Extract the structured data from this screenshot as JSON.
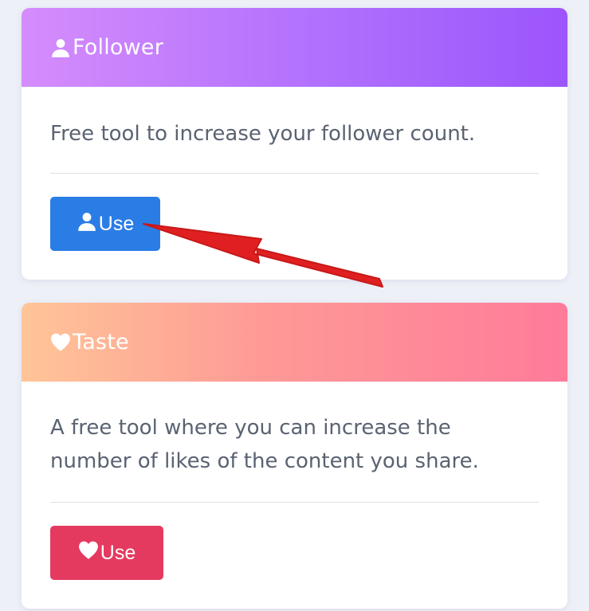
{
  "follower_card": {
    "title": "Follower",
    "icon": "user-icon",
    "description": "Free tool to increase your follower count.",
    "button_label": "Use",
    "button_color": "#2b7de6",
    "header_gradient": [
      "#d58cfc",
      "#9c55fb"
    ]
  },
  "taste_card": {
    "title": "Taste",
    "icon": "heart-icon",
    "description_line1": "A free tool where you can increase the",
    "description_line2": "number of likes of the content you share.",
    "button_label": "Use",
    "button_color": "#e53a5f",
    "header_gradient": [
      "#ffc597",
      "#fe7b9a"
    ]
  },
  "annotation": {
    "icon": "red-arrow-icon",
    "color": "#e02020"
  }
}
